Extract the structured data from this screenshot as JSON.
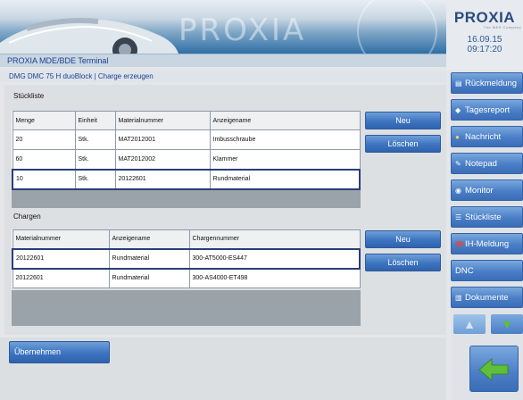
{
  "header": {
    "watermark": "PROXIA",
    "title": "PROXIA MDE/BDE Terminal",
    "logo": "PROXIA",
    "logo_tag": "The MES Company",
    "date": "16.09.15",
    "time": "09:17:20"
  },
  "subheader": {
    "text": "DMG DMC 75 H duoBlock | Charge erzeugen"
  },
  "stueckliste": {
    "label": "Stückliste",
    "columns": [
      "Menge",
      "Einheit",
      "Materialnummer",
      "Anzeigename"
    ],
    "rows": [
      [
        "20",
        "Stk.",
        "MAT2012001",
        "Imbusschraube"
      ],
      [
        "60",
        "Stk.",
        "MAT2012002",
        "Klammer"
      ],
      [
        "10",
        "Stk.",
        "20122601",
        "Rundmaterial"
      ]
    ],
    "new_label": "Neu",
    "delete_label": "Löschen"
  },
  "chargen": {
    "label": "Chargen",
    "columns": [
      "Materialnummer",
      "Anzeigename",
      "Chargennummer"
    ],
    "rows": [
      [
        "20122601",
        "Rundmaterial",
        "300-AT5000-ES447"
      ],
      [
        "20122601",
        "Rundmaterial",
        "300-AS4000-ET498"
      ]
    ],
    "new_label": "Neu",
    "delete_label": "Löschen"
  },
  "accept_label": "Übernehmen",
  "sidebar": {
    "items": [
      {
        "label": "Rückmeldung",
        "icon": "report-icon"
      },
      {
        "label": "Tagesreport",
        "icon": "calendar-icon"
      },
      {
        "label": "Nachricht",
        "icon": "message-icon"
      },
      {
        "label": "Notepad",
        "icon": "notepad-icon"
      },
      {
        "label": "Monitor",
        "icon": "monitor-icon"
      },
      {
        "label": "Stückliste",
        "icon": "list-icon"
      },
      {
        "label": "IH-Meldung",
        "icon": "phone-icon"
      },
      {
        "label": "DNC",
        "icon": ""
      },
      {
        "label": "Dokumente",
        "icon": "documents-icon"
      }
    ]
  },
  "colors": {
    "accent": "#3d74c0",
    "title_text": "#1b3f8f",
    "arrow_green": "#5fbf3a"
  }
}
